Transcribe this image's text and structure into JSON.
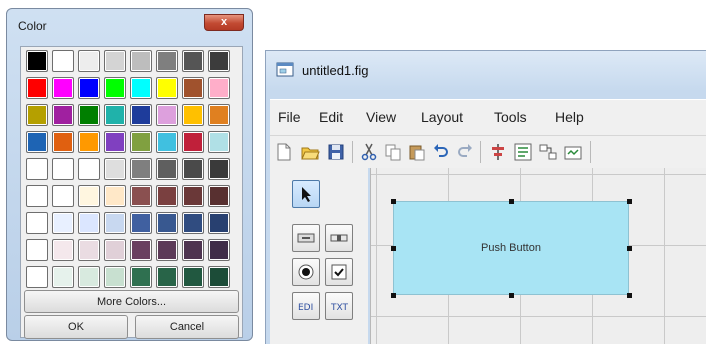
{
  "color_dialog": {
    "title": "Color",
    "close_glyph": "x",
    "swatch_rows": [
      [
        "#000000",
        "#ffffff",
        "#ededed",
        "#d4d4d4",
        "#bdbdbd",
        "#7f7f7f",
        "#555555",
        "#3c3c3c"
      ],
      [
        "#ff0000",
        "#ff00ff",
        "#0000ff",
        "#00ff00",
        "#00ffff",
        "#ffff00",
        "#a0522d",
        "#ffaec9"
      ],
      [
        "#b5a000",
        "#a020a0",
        "#007f00",
        "#20b2aa",
        "#1e3c9b",
        "#dda0dd",
        "#ffc000",
        "#e08020"
      ],
      [
        "#1e64b4",
        "#e06010",
        "#ff9900",
        "#8040c0",
        "#80a040",
        "#40c0e0",
        "#c0203a",
        "#b0e0e6"
      ],
      [
        "#ffffff",
        "#ffffff",
        "#ffffff",
        "#dedede",
        "#7f7f7f",
        "#5f5f5f",
        "#4a4a4a",
        "#3a3a3a"
      ],
      [
        "#ffffff",
        "#ffffff",
        "#fff6e0",
        "#ffe8c8",
        "#8a5050",
        "#7a4040",
        "#6a3838",
        "#583030"
      ],
      [
        "#ffffff",
        "#e8f0ff",
        "#dbe6ff",
        "#c8d8f0",
        "#4060a0",
        "#385890",
        "#304c80",
        "#284070"
      ],
      [
        "#ffffff",
        "#f4e8ec",
        "#eadce2",
        "#e0d0d8",
        "#6a4060",
        "#5c3a58",
        "#4e3450",
        "#402c48"
      ],
      [
        "#ffffff",
        "#e6f2ec",
        "#d8eadf",
        "#c8e0d0",
        "#2f7050",
        "#286448",
        "#215840",
        "#1c4c38"
      ]
    ],
    "more_colors_label": "More Colors...",
    "ok_label": "OK",
    "cancel_label": "Cancel",
    "accent_colors": {
      "frame": "#c6d9ee",
      "close": "#c24a33"
    }
  },
  "guide_window": {
    "title": "untitled1.fig",
    "menu": [
      "File",
      "Edit",
      "View",
      "Layout",
      "Tools",
      "Help"
    ],
    "toolbar_icons": [
      "new-file-icon",
      "open-folder-icon",
      "save-icon",
      "cut-icon",
      "copy-icon",
      "paste-icon",
      "undo-icon",
      "redo-icon",
      "align-icon",
      "menu-editor-icon",
      "tab-order-icon",
      "toolbar-editor-icon"
    ],
    "palette_icons": [
      "select-arrow-icon",
      "push-button-icon",
      "slider-icon",
      "radio-button-icon",
      "checkbox-icon",
      "edit-text-icon",
      "static-text-icon"
    ],
    "canvas": {
      "push_button_label": "Push Button",
      "push_button_color": "#a8e4f4"
    }
  }
}
